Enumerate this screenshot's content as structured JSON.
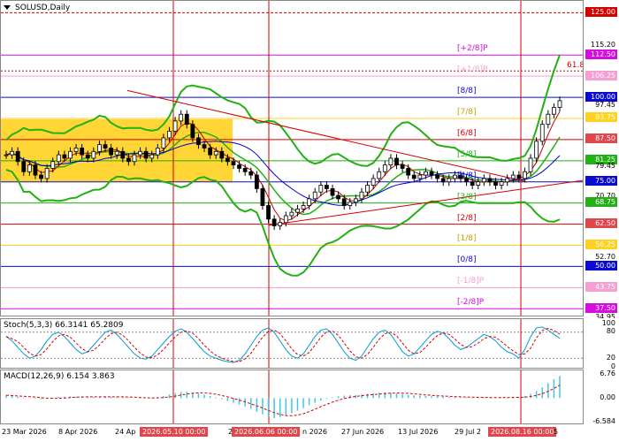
{
  "symbol": "SOLUSD,Daily",
  "colors": {
    "red_line": "#d40000",
    "blue_line": "#0000d0",
    "green": "#22b014",
    "yellow_zone": "#ffd21f",
    "pink": "#f59fd2",
    "candle": "#000000"
  },
  "price_scale": [
    {
      "text": "125.00",
      "value": 125.0,
      "bg": "#d40000",
      "fg": "#ffffff"
    },
    {
      "text": "115.20",
      "value": 115.2,
      "bg": "",
      "fg": "#000000"
    },
    {
      "text": "112.50",
      "value": 112.5,
      "bg": "#d40de0",
      "fg": "#ffffff"
    },
    {
      "text": "106.25",
      "value": 106.25,
      "bg": "#f59fd2",
      "fg": "#ffffff"
    },
    {
      "text": "100.00",
      "value": 100.0,
      "bg": "#0a0ad0",
      "fg": "#ffffff"
    },
    {
      "text": "97.45",
      "value": 97.45,
      "bg": "",
      "fg": "#000000"
    },
    {
      "text": "93.75",
      "value": 93.75,
      "bg": "#ffd21f",
      "fg": "#ffffff"
    },
    {
      "text": "87.50",
      "value": 87.5,
      "bg": "#e0474c",
      "fg": "#ffffff"
    },
    {
      "text": "81.25",
      "value": 81.25,
      "bg": "#22b014",
      "fg": "#ffffff"
    },
    {
      "text": "79.45",
      "value": 79.45,
      "bg": "",
      "fg": "#000000"
    },
    {
      "text": "75.00",
      "value": 75.0,
      "bg": "#0a0ad0",
      "fg": "#ffffff"
    },
    {
      "text": "70.70",
      "value": 70.7,
      "bg": "",
      "fg": "#000000"
    },
    {
      "text": "68.75",
      "value": 68.75,
      "bg": "#22b014",
      "fg": "#ffffff"
    },
    {
      "text": "62.50",
      "value": 62.5,
      "bg": "#e0474c",
      "fg": "#ffffff"
    },
    {
      "text": "56.25",
      "value": 56.25,
      "bg": "#ffd21f",
      "fg": "#ffffff"
    },
    {
      "text": "52.70",
      "value": 52.7,
      "bg": "",
      "fg": "#000000"
    },
    {
      "text": "50.00",
      "value": 50.0,
      "bg": "#0a0ad0",
      "fg": "#ffffff"
    },
    {
      "text": "43.75",
      "value": 43.75,
      "bg": "#f59fd2",
      "fg": "#ffffff"
    },
    {
      "text": "37.50",
      "value": 37.5,
      "bg": "#d40de0",
      "fg": "#ffffff"
    },
    {
      "text": "34.95",
      "value": 34.95,
      "bg": "",
      "fg": "#000000"
    }
  ],
  "murrey_labels": [
    {
      "text": "[+2/8]P",
      "value": 112.5,
      "color": "#d40de0"
    },
    {
      "text": "[+1/8]P",
      "value": 106.25,
      "color": "#f59fd2"
    },
    {
      "text": "[8/8]",
      "value": 100.0,
      "color": "#0a0ad0"
    },
    {
      "text": "[7/8]",
      "value": 93.75,
      "color": "#c8a000"
    },
    {
      "text": "[6/8]",
      "value": 87.5,
      "color": "#d40000"
    },
    {
      "text": "[5/8]",
      "value": 81.25,
      "color": "#22b014"
    },
    {
      "text": "[4/8]",
      "value": 75.0,
      "color": "#0a0ad0"
    },
    {
      "text": "[3/8]",
      "value": 68.75,
      "color": "#22b014"
    },
    {
      "text": "[2/8]",
      "value": 62.5,
      "color": "#d40000"
    },
    {
      "text": "[1/8]",
      "value": 56.25,
      "color": "#c8a000"
    },
    {
      "text": "[0/8]",
      "value": 50.0,
      "color": "#0a0ad0"
    },
    {
      "text": "[-1/8]P",
      "value": 43.75,
      "color": "#f59fd2"
    },
    {
      "text": "[-2/8]P",
      "value": 37.5,
      "color": "#d40de0"
    }
  ],
  "fib_label": {
    "text": "61.8",
    "value": 107.8
  },
  "stoch": {
    "title": "Stoch(5,3,3) 66.3141 65.2809",
    "scale": [
      "100",
      "80",
      "20",
      "0"
    ]
  },
  "macd": {
    "title": "MACD(12,26,9) 6.154 3.863",
    "scale": [
      "6.76",
      "0.00",
      "-6.584"
    ]
  },
  "time_axis": [
    {
      "text": "23 Mar 2026",
      "highlight": false
    },
    {
      "text": "8 Apr 2026",
      "highlight": false
    },
    {
      "text": "24 Ap",
      "highlight": false
    },
    {
      "text": "2026.05.10 00:00",
      "highlight": true
    },
    {
      "text": "2",
      "highlight": false
    },
    {
      "text": "2026.06.06 00:00",
      "highlight": true
    },
    {
      "text": "n 2026",
      "highlight": false
    },
    {
      "text": "27 Jun 2026",
      "highlight": false
    },
    {
      "text": "13 Jul 2026",
      "highlight": false
    },
    {
      "text": "29 Jul 2",
      "highlight": false
    },
    {
      "text": "2026.08.16 00:00",
      "highlight": true
    },
    {
      "text": "5",
      "highlight": false
    }
  ],
  "chart_data": [
    {
      "type": "candlestick",
      "title": "SOLUSD,Daily",
      "ylim": [
        34.95,
        128.5
      ],
      "horizontal_levels": [
        125.0,
        112.5,
        106.25,
        100.0,
        93.75,
        87.5,
        81.25,
        75.0,
        68.75,
        62.5,
        56.25,
        50.0,
        43.75,
        37.5
      ],
      "close_series_estimate": [
        83,
        84,
        81,
        78,
        80,
        77,
        76,
        79,
        81,
        83,
        82,
        84,
        85,
        83,
        82,
        84,
        86,
        85,
        83,
        84,
        82,
        81,
        83,
        84,
        82,
        83,
        85,
        88,
        90,
        93,
        95,
        92,
        88,
        86,
        85,
        83,
        84,
        82,
        81,
        80,
        79,
        78,
        77,
        73,
        68,
        64,
        62,
        63,
        65,
        66,
        67,
        68,
        70,
        72,
        74,
        73,
        71,
        70,
        68,
        69,
        70,
        72,
        74,
        76,
        78,
        80,
        82,
        80,
        79,
        77,
        76,
        77,
        78,
        77,
        76,
        75,
        76,
        77,
        76,
        75,
        74,
        75,
        76,
        75,
        74,
        75,
        76,
        77,
        76,
        78,
        82,
        87,
        92,
        95,
        97,
        99
      ]
    },
    {
      "type": "line",
      "title": "Stoch(5,3,3) 66.3141 65.2809",
      "ylim": [
        0,
        100
      ],
      "series": [
        {
          "name": "",
          "values": [
            70,
            60,
            45,
            30,
            20,
            25,
            40,
            60,
            75,
            80,
            70,
            55,
            40,
            30,
            35,
            50,
            65,
            80,
            85,
            75,
            60,
            45,
            30,
            20,
            18,
            25,
            40,
            55,
            70,
            82,
            88,
            80,
            65,
            50,
            35,
            25,
            20,
            15,
            12,
            10,
            15,
            30,
            50,
            70,
            85,
            90,
            80,
            60,
            40,
            25,
            20,
            30,
            50,
            70,
            85,
            88,
            75,
            55,
            35,
            20,
            15,
            25,
            45,
            65,
            80,
            85,
            75,
            55,
            35,
            25,
            30,
            45,
            60,
            75,
            82,
            78,
            65,
            50,
            40,
            45,
            55,
            65,
            75,
            70,
            60,
            45,
            35,
            30,
            20,
            40,
            70,
            90,
            92,
            85,
            75,
            66
          ]
        }
      ]
    },
    {
      "type": "bar",
      "title": "MACD(12,26,9) 6.154 3.863",
      "ylim": [
        -6.584,
        6.76
      ],
      "series": [
        {
          "name": "",
          "values": [
            0.8,
            0.6,
            0.4,
            0.2,
            0.0,
            -0.2,
            -0.3,
            -0.2,
            0.1,
            0.3,
            0.4,
            0.5,
            0.4,
            0.3,
            0.2,
            0.3,
            0.4,
            0.5,
            0.4,
            0.3,
            0.2,
            0.1,
            0.0,
            -0.1,
            0.0,
            0.1,
            0.3,
            0.6,
            1.0,
            1.4,
            1.7,
            1.8,
            1.6,
            1.3,
            1.0,
            0.6,
            0.2,
            -0.3,
            -0.8,
            -1.3,
            -1.8,
            -2.3,
            -3.0,
            -3.8,
            -4.5,
            -5.2,
            -5.6,
            -5.3,
            -4.8,
            -4.2,
            -3.5,
            -2.8,
            -2.0,
            -1.3,
            -0.7,
            -0.2,
            0.2,
            0.5,
            0.7,
            0.8,
            0.9,
            1.0,
            1.2,
            1.4,
            1.5,
            1.6,
            1.5,
            1.3,
            1.1,
            0.9,
            0.8,
            0.7,
            0.6,
            0.5,
            0.5,
            0.4,
            0.3,
            0.3,
            0.2,
            0.2,
            0.1,
            0.1,
            0.2,
            0.2,
            0.1,
            0.1,
            0.2,
            0.3,
            0.3,
            0.6,
            1.2,
            2.0,
            3.0,
            4.2,
            5.3,
            6.2
          ]
        }
      ]
    }
  ]
}
